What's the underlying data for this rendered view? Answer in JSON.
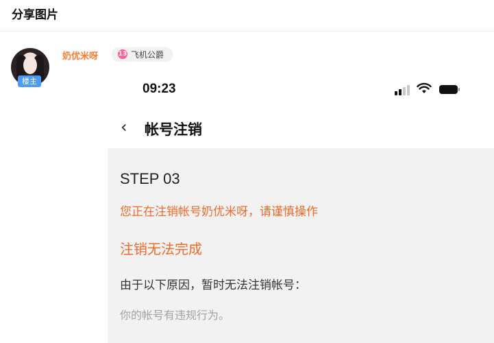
{
  "header": {
    "title": "分享图片"
  },
  "post": {
    "author": {
      "name": "奶优米呀",
      "role_badge": "楼主",
      "level_number": "13",
      "level_title": "飞机公爵"
    }
  },
  "screenshot": {
    "status_bar": {
      "time": "09:23"
    },
    "nav": {
      "title": "帐号注销"
    },
    "content": {
      "step": "STEP 03",
      "warning": "您正在注销帐号奶优米呀，请谨慎操作",
      "result_title": "注销无法完成",
      "reason_heading": "由于以下原因，暂时无法注销帐号：",
      "reasons": [
        "你的帐号有违规行为。"
      ]
    }
  },
  "colors": {
    "accent_orange": "#f2692a",
    "username_orange": "#ff7a2e",
    "owner_badge_blue": "#4d9bf0",
    "panel_gray": "#f2f2f2"
  }
}
